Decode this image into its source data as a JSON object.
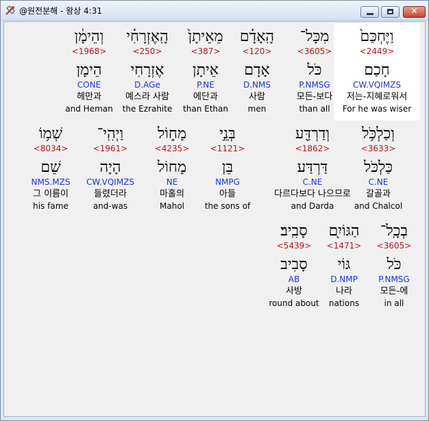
{
  "window": {
    "title": "@원전분해 - 왕상 4:31"
  },
  "rows": [
    [
      {
        "heb": "וְהֵימָ֔ן",
        "num": "<1968>",
        "lemma": "הֵימָן",
        "morph": "CONE",
        "kor": "헤만과",
        "eng": "and Heman"
      },
      {
        "heb": "הָֽאֶזְרָחִ֗י",
        "num": "<250>",
        "lemma": "אֶזְרָחִי",
        "morph": "D.AGe",
        "kor": "예스라 사람",
        "eng": "the Ezrahite"
      },
      {
        "heb": "מֵאֵיתָן֙",
        "num": "<387>",
        "lemma": "אֵיתָן",
        "morph": "P.NE",
        "kor": "에단과",
        "eng": "than Ethan"
      },
      {
        "heb": "הָֽאָדָ֗ם",
        "num": "<120>",
        "lemma": "אָדָם",
        "morph": "D.NMS",
        "kor": "사람",
        "eng": "men"
      },
      {
        "heb": "מִכָּל־",
        "num": "<3605>",
        "lemma": "כֹּל",
        "morph": "P.NMSG",
        "kor": "모든-보다",
        "eng": "than all"
      },
      {
        "heb": "וַיֶּחְכַּם֙",
        "num": "<2449>",
        "lemma": "חָכַם",
        "morph": "CW.VQIMZS",
        "kor": "저는-지혜로워서",
        "eng": "For he was wiser",
        "highlight": true
      }
    ],
    [
      {
        "heb": "שְׁמ֥וֹ",
        "num": "<8034>",
        "lemma": "שֵׁם",
        "morph": "NMS.MZS",
        "kor": "그 이름이",
        "eng": "his fame"
      },
      {
        "heb": "וַיְהִֽי־",
        "num": "<1961>",
        "lemma": "הָיָה",
        "morph": "CW.VQIMZS",
        "kor": "들렸더라",
        "eng": "and-was"
      },
      {
        "heb": "מָח֑וֹל",
        "num": "<4235>",
        "lemma": "מָחוֹל",
        "morph": "NE",
        "kor": "마홀의",
        "eng": "Mahol"
      },
      {
        "heb": "בְּנֵ֣י",
        "num": "<1121>",
        "lemma": "בֵּן",
        "morph": "NMPG",
        "kor": "아들",
        "eng": "the sons of"
      },
      {
        "heb": "וְדַרְדַּ֖ע",
        "num": "<1862>",
        "lemma": "דַּרְדַּע",
        "morph": "C.NE",
        "kor": "다르다보다 나으므로",
        "eng": "and Darda"
      },
      {
        "heb": "וְכַלְכֹּ֥ל",
        "num": "<3633>",
        "lemma": "כַּלְכֹּל",
        "morph": "C.NE",
        "kor": "갈골과",
        "eng": "and Chalcol"
      }
    ],
    [
      {
        "heb": "סָבִֽיב׃",
        "num": "<5439>",
        "lemma": "סָבִיב",
        "morph": "AB",
        "kor": "사방",
        "eng": "round about"
      },
      {
        "heb": "הַגּוֹיִ֖ם",
        "num": "<1471>",
        "lemma": "גּוֹי",
        "morph": "D.NMP",
        "kor": "나라",
        "eng": "nations"
      },
      {
        "heb": "בְכָֽל־",
        "num": "<3605>",
        "lemma": "כֹּל",
        "morph": "P.NMSG",
        "kor": "모든-에",
        "eng": "in all"
      }
    ]
  ]
}
